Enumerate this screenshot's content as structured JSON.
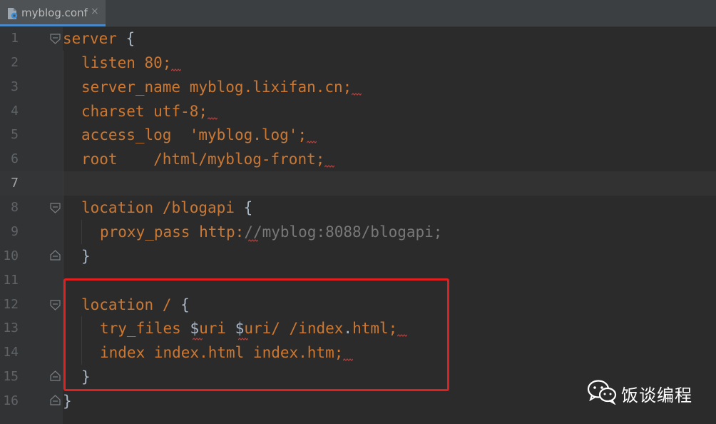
{
  "tab": {
    "title": "myblog.conf",
    "close": "×",
    "icon": "nginx-config-file-icon"
  },
  "editor": {
    "current_line": 7,
    "lines": [
      {
        "no": "1",
        "text": "server {"
      },
      {
        "no": "2",
        "text": "listen 80;"
      },
      {
        "no": "3",
        "text": "server_name myblog.lixifan.cn;"
      },
      {
        "no": "4",
        "text": "charset utf-8;"
      },
      {
        "no": "5",
        "text": "access_log  'myblog.log';"
      },
      {
        "no": "6",
        "text": "root    /html/myblog-front;"
      },
      {
        "no": "7",
        "text": ""
      },
      {
        "no": "8",
        "text": "location /blogapi {"
      },
      {
        "no": "9",
        "text": "proxy_pass http://myblog:8088/blogapi;"
      },
      {
        "no": "10",
        "text": "}"
      },
      {
        "no": "11",
        "text": ""
      },
      {
        "no": "12",
        "text": "location / {"
      },
      {
        "no": "13",
        "text": "try_files $uri $uri/ /index.html;"
      },
      {
        "no": "14",
        "text": "index index.html index.htm;"
      },
      {
        "no": "15",
        "text": "}"
      },
      {
        "no": "16",
        "text": "}"
      }
    ],
    "tokens": {
      "l1_kw": "server",
      "l1_brace": " {",
      "l2_kw": "listen",
      "l2_val": " 80;",
      "l3_kw": "server_name",
      "l3_val": " myblog.lixifan.cn;",
      "l4_kw": "charset",
      "l4_val": " utf-8;",
      "l5_kw": "access_log",
      "l5_val": "  'myblog.log';",
      "l6_kw": "root",
      "l6_val": "    /html/myblog-front;",
      "l8_kw": "location",
      "l8_val": " /blogapi",
      "l8_brace": " {",
      "l9_kw": "proxy_pass",
      "l9_val": " http:",
      "l9_url": "//myblog:8088/blogapi;",
      "l10": "}",
      "l12_kw": "location",
      "l12_val": " / ",
      "l12_brace": "{",
      "l13_kw": "try_files",
      "l13_sp1": " ",
      "l13_d1": "$",
      "l13_v1": "uri ",
      "l13_d2": "$",
      "l13_v2": "uri/ /index",
      "l13_dot": ".",
      "l13_end": "html;",
      "l14_kw": "index",
      "l14_val": " index.html index.htm;",
      "l15": "}",
      "l16": "}"
    }
  },
  "watermark": {
    "text": "饭谈编程",
    "icon": "wechat-icon"
  },
  "colors": {
    "background": "#2b2b2b",
    "keyword": "#cc7832",
    "text": "#a9b7c6",
    "url_comment": "#787878",
    "highlight_box": "#e02020"
  }
}
